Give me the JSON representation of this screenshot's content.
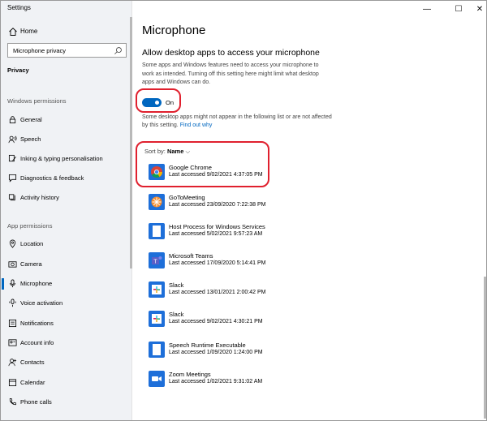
{
  "window": {
    "title": "Settings",
    "minimize_glyph": "—",
    "maximize_glyph": "☐",
    "close_glyph": "✕"
  },
  "sidebar": {
    "home_label": "Home",
    "search_value": "Microphone privacy",
    "active_section": "Privacy",
    "windows_permissions_title": "Windows permissions",
    "windows_permissions": [
      {
        "label": "General",
        "icon": "lock-icon"
      },
      {
        "label": "Speech",
        "icon": "speech-icon"
      },
      {
        "label": "Inking & typing personalisation",
        "icon": "inking-icon"
      },
      {
        "label": "Diagnostics & feedback",
        "icon": "feedback-icon"
      },
      {
        "label": "Activity history",
        "icon": "activity-history-icon"
      }
    ],
    "app_permissions_title": "App permissions",
    "app_permissions": [
      {
        "label": "Location",
        "icon": "location-icon"
      },
      {
        "label": "Camera",
        "icon": "camera-icon"
      },
      {
        "label": "Microphone",
        "icon": "microphone-icon",
        "active": true
      },
      {
        "label": "Voice activation",
        "icon": "voice-activation-icon"
      },
      {
        "label": "Notifications",
        "icon": "notifications-icon"
      },
      {
        "label": "Account info",
        "icon": "account-info-icon"
      },
      {
        "label": "Contacts",
        "icon": "contacts-icon"
      },
      {
        "label": "Calendar",
        "icon": "calendar-icon"
      },
      {
        "label": "Phone calls",
        "icon": "phone-icon"
      }
    ]
  },
  "main": {
    "title": "Microphone",
    "heading": "Allow desktop apps to access your microphone",
    "description": "Some apps and Windows features need to access your microphone to work as intended. Turning off this setting here might limit what desktop apps and Windows can do.",
    "toggle_label": "On",
    "note": "Some desktop apps might not appear in the following list or are not affected by this setting.",
    "note_link": "Find out why",
    "sort_label": "Sort by:",
    "sort_value": "Name",
    "apps": [
      {
        "name": "Google Chrome",
        "last": "Last accessed 9/02/2021 4:37:05 PM",
        "icon": "chrome-icon"
      },
      {
        "name": "GoToMeeting",
        "last": "Last accessed 23/09/2020 7:22:38 PM",
        "icon": "gotomeeting-icon"
      },
      {
        "name": "Host Process for Windows Services",
        "last": "Last accessed 5/02/2021 9:57:23 AM",
        "icon": "host-process-icon"
      },
      {
        "name": "Microsoft Teams",
        "last": "Last accessed 17/09/2020 5:14:41 PM",
        "icon": "teams-icon"
      },
      {
        "name": "Slack",
        "last": "Last accessed 13/01/2021 2:00:42 PM",
        "icon": "slack-icon"
      },
      {
        "name": "Slack",
        "last": "Last accessed 9/02/2021 4:30:21 PM",
        "icon": "slack-icon"
      },
      {
        "name": "Speech Runtime Executable",
        "last": "Last accessed 1/09/2020 1:24:00 PM",
        "icon": "speech-runtime-icon"
      },
      {
        "name": "Zoom Meetings",
        "last": "Last accessed 1/02/2021 9:31:02 AM",
        "icon": "zoom-icon"
      }
    ]
  },
  "colors": {
    "accent": "#0067c0",
    "highlight": "#e0202e",
    "sidebar_bg": "#f0f2f5"
  }
}
